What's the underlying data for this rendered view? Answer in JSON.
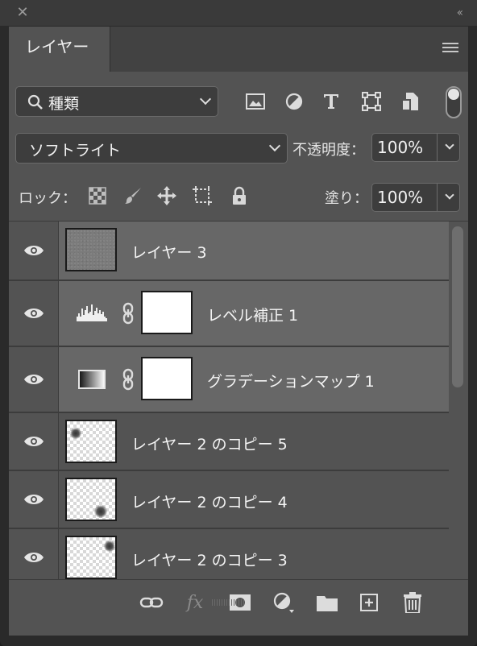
{
  "window": {
    "close_glyph": "✕",
    "collapse_glyph": "‹‹"
  },
  "panel": {
    "tab_label": "レイヤー"
  },
  "filter": {
    "kind_label": "種類",
    "icons": [
      "image-filter-icon",
      "adjustment-filter-icon",
      "type-filter-icon",
      "shape-filter-icon",
      "smart-object-filter-icon"
    ]
  },
  "blend": {
    "mode": "ソフトライト",
    "opacity_label": "不透明度：",
    "opacity_value": "100%"
  },
  "lock": {
    "label": "ロック：",
    "fill_label": "塗り：",
    "fill_value": "100%"
  },
  "layers": [
    {
      "name": "レイヤー 3",
      "type": "pixel",
      "thumb": "noise",
      "selected": true
    },
    {
      "name": "レベル補正 1",
      "type": "adjustment",
      "adj_icon": "levels-icon",
      "selected": true
    },
    {
      "name": "グラデーションマップ 1",
      "type": "adjustment",
      "adj_icon": "gradient-map-icon",
      "selected": true
    },
    {
      "name": "レイヤー 2 のコピー 5",
      "type": "pixel",
      "thumb": "check",
      "selected": false
    },
    {
      "name": "レイヤー 2 のコピー 4",
      "type": "pixel",
      "thumb": "check",
      "selected": false
    },
    {
      "name": "レイヤー 2 のコピー 3",
      "type": "pixel",
      "thumb": "check",
      "selected": false
    }
  ],
  "bottom": {
    "icons": [
      "link-layers-icon",
      "fx-icon",
      "layer-mask-icon",
      "new-adjustment-icon",
      "new-group-icon",
      "new-layer-icon",
      "delete-layer-icon"
    ],
    "fx_label": "fx"
  }
}
